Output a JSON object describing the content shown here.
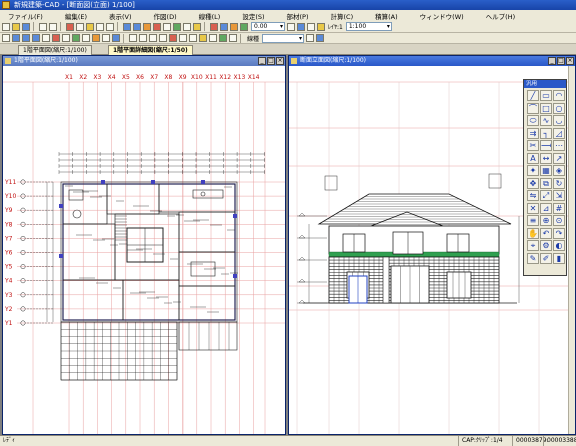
{
  "window": {
    "title": "新規建築-CAD  - [断面図(立面) 1/100]"
  },
  "menubar": {
    "items": [
      "ファイル(F)",
      "編集(E)",
      "表示(V)",
      "作図(D)",
      "線種(L)",
      "設定(S)",
      "部材(P)",
      "計算(C)",
      "積算(A)",
      "ウィンドウ(W)",
      "ヘルプ(H)"
    ]
  },
  "toolbar": {
    "layer_combo": "0.00",
    "scale_combo": "1:100",
    "line_label": "線種",
    "layer_label": "ﾚｲﾔ:1"
  },
  "tabs": [
    {
      "label": "1階平面図(縮尺:1/100)"
    },
    {
      "label": "1階平面詳細図(縮尺:1/50)"
    }
  ],
  "plan_window": {
    "title": "1階平面図(縮尺:1/100)",
    "x_axis_labels": [
      "X1",
      "X2",
      "X3",
      "X4",
      "X5",
      "X6",
      "X7",
      "X8",
      "X9",
      "X10",
      "X11",
      "X12",
      "X13",
      "X14"
    ],
    "y_axis_labels": [
      "Y11",
      "Y10",
      "Y9",
      "Y8",
      "Y7",
      "Y6",
      "Y5",
      "Y4",
      "Y3",
      "Y2",
      "Y1"
    ]
  },
  "elevation_window": {
    "title": "断面立面図(縮尺:1/100)"
  },
  "palette": {
    "title": "汎用",
    "tools": [
      "line-tool",
      "rect-tool",
      "arc-tool",
      "polyline-tool",
      "square-tool",
      "circle-tool",
      "ellipse-tool",
      "curve-tool",
      "arc3-tool",
      "offset-tool",
      "fillet-tool",
      "chamfer-tool",
      "trim-tool",
      "extend-tool",
      "break-tool",
      "text-tool",
      "dim-tool",
      "leader-tool",
      "symbol-tool",
      "hatch-tool",
      "paint-tool",
      "move-tool",
      "copy-tool",
      "rotate-tool",
      "mirror-tool",
      "scale-tool",
      "stretch-tool",
      "erase-tool",
      "measure-tool",
      "grid-tool",
      "layer-tool",
      "snap-tool",
      "zoom-tool",
      "pan-tool",
      "undo-tool",
      "redo-tool",
      "pick-tool",
      "attr-tool",
      "color-tool",
      "pen-tool",
      "pencil-tool",
      "marker-tool"
    ]
  },
  "status": {
    "left": "ﾚﾃﾞｨ",
    "cap": "CAP:ｸﾘｯﾌﾟ:1/4",
    "coord_x": "00003879.",
    "coord_y": "00003388"
  }
}
